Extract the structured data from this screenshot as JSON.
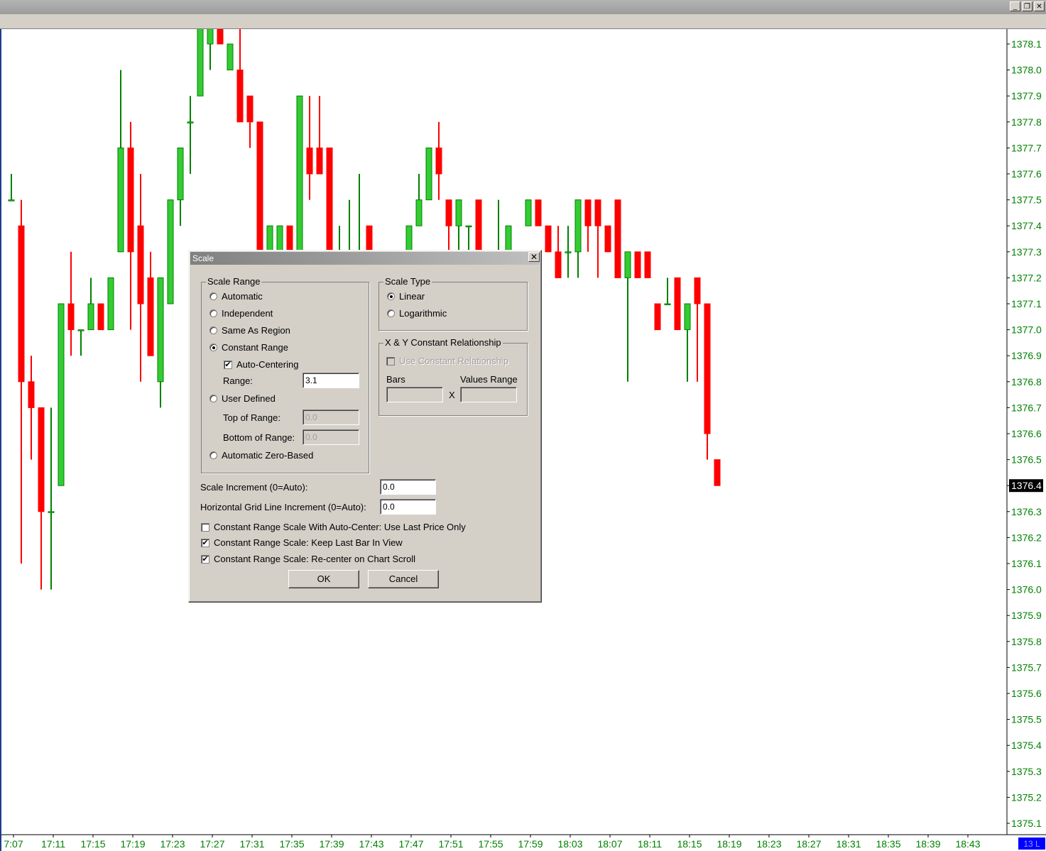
{
  "window": {
    "controls": [
      "_",
      "❐",
      "✕"
    ]
  },
  "colors": {
    "up": "#33cc33",
    "down": "#ff0000",
    "axis_text": "#008000",
    "last_bg": "#000000",
    "last_fg": "#ffffff",
    "time_text": "#008000",
    "corner_box": "#0000ff"
  },
  "chart_data": {
    "type": "candlestick",
    "y_ticks": [
      "1378.1",
      "1378.0",
      "1377.9",
      "1377.8",
      "1377.7",
      "1377.6",
      "1377.5",
      "1377.4",
      "1377.3",
      "1377.2",
      "1377.1",
      "1377.0",
      "1376.9",
      "1376.8",
      "1376.7",
      "1376.6",
      "1376.5",
      "1376.4",
      "1376.3",
      "1376.2",
      "1376.1",
      "1376.0",
      "1375.9",
      "1375.8",
      "1375.7",
      "1375.6",
      "1375.5",
      "1375.4",
      "1375.3",
      "1375.2",
      "1375.1"
    ],
    "last_price": "1376.4",
    "x_ticks": [
      "7:07",
      "17:11",
      "17:15",
      "17:19",
      "17:23",
      "17:27",
      "17:31",
      "17:35",
      "17:39",
      "17:43",
      "17:47",
      "17:51",
      "17:55",
      "17:59",
      "18:03",
      "18:07",
      "18:11",
      "18:15",
      "18:19",
      "18:23",
      "18:27",
      "18:31",
      "18:35",
      "18:39",
      "18:43"
    ],
    "corner_label": "13 L",
    "bars": [
      [
        1377.5,
        1377.6,
        1377.5,
        1377.5
      ],
      [
        1377.4,
        1377.5,
        1376.1,
        1376.8
      ],
      [
        1376.8,
        1376.9,
        1376.5,
        1376.7
      ],
      [
        1376.7,
        1376.7,
        1376.0,
        1376.3
      ],
      [
        1376.3,
        1376.7,
        1376.0,
        1376.3
      ],
      [
        1376.4,
        1377.1,
        1376.4,
        1377.1
      ],
      [
        1377.1,
        1377.3,
        1376.9,
        1377.0
      ],
      [
        1377.0,
        1377.0,
        1376.9,
        1377.0
      ],
      [
        1377.0,
        1377.2,
        1377.0,
        1377.1
      ],
      [
        1377.1,
        1377.1,
        1377.0,
        1377.0
      ],
      [
        1377.0,
        1377.2,
        1377.0,
        1377.2
      ],
      [
        1377.3,
        1378.0,
        1377.3,
        1377.7
      ],
      [
        1377.7,
        1377.8,
        1377.0,
        1377.3
      ],
      [
        1377.4,
        1377.6,
        1376.8,
        1377.1
      ],
      [
        1377.2,
        1377.3,
        1376.9,
        1376.9
      ],
      [
        1376.8,
        1377.2,
        1376.7,
        1377.2
      ],
      [
        1377.1,
        1377.5,
        1377.1,
        1377.5
      ],
      [
        1377.5,
        1377.7,
        1377.4,
        1377.7
      ],
      [
        1377.8,
        1377.9,
        1377.6,
        1377.8
      ],
      [
        1377.9,
        1378.2,
        1377.9,
        1378.2
      ],
      [
        1378.1,
        1378.2,
        1378.0,
        1378.2
      ],
      [
        1378.2,
        1378.2,
        1378.1,
        1378.1
      ],
      [
        1378.0,
        1378.1,
        1378.0,
        1378.1
      ],
      [
        1378.0,
        1378.2,
        1377.9,
        1377.8
      ],
      [
        1377.9,
        1377.9,
        1377.7,
        1377.8
      ],
      [
        1377.8,
        1377.8,
        1377.3,
        1377.3
      ],
      [
        1377.3,
        1377.4,
        1377.3,
        1377.4
      ],
      [
        1377.3,
        1377.4,
        1377.3,
        1377.4
      ],
      [
        1377.4,
        1377.4,
        1377.3,
        1377.3
      ],
      [
        1377.3,
        1377.6,
        1377.3,
        1377.9
      ],
      [
        1377.7,
        1377.9,
        1377.5,
        1377.6
      ],
      [
        1377.7,
        1377.9,
        1377.6,
        1377.6
      ],
      [
        1377.7,
        1377.7,
        1377.3,
        1377.3
      ],
      [
        1377.3,
        1377.4,
        1377.3,
        1377.3
      ],
      [
        1377.0,
        1377.5,
        1377.0,
        1377.3
      ],
      [
        1377.3,
        1377.6,
        1377.3,
        1377.3
      ],
      [
        1377.4,
        1377.4,
        1377.0,
        1377.1
      ],
      [
        1377.0,
        1377.3,
        1377.0,
        1377.1
      ],
      [
        1377.0,
        1377.2,
        1376.9,
        1377.2
      ],
      [
        1377.3,
        1377.3,
        1377.1,
        1377.1
      ],
      [
        1377.2,
        1377.4,
        1377.2,
        1377.4
      ],
      [
        1377.4,
        1377.6,
        1377.4,
        1377.5
      ],
      [
        1377.5,
        1377.7,
        1377.5,
        1377.7
      ],
      [
        1377.7,
        1377.8,
        1377.5,
        1377.6
      ],
      [
        1377.5,
        1377.5,
        1377.3,
        1377.4
      ],
      [
        1377.4,
        1377.5,
        1377.3,
        1377.5
      ],
      [
        1377.4,
        1377.4,
        1377.2,
        1377.4
      ],
      [
        1377.5,
        1377.5,
        1377.1,
        1377.3
      ],
      [
        1377.2,
        1377.3,
        1377.2,
        1377.3
      ],
      [
        1377.3,
        1377.5,
        1377.2,
        1377.3
      ],
      [
        1377.3,
        1377.4,
        1377.3,
        1377.4
      ],
      [
        1377.3,
        1377.3,
        1377.3,
        1377.3
      ],
      [
        1377.4,
        1377.5,
        1377.4,
        1377.5
      ],
      [
        1377.5,
        1377.5,
        1377.4,
        1377.4
      ],
      [
        1377.4,
        1377.4,
        1377.3,
        1377.3
      ],
      [
        1377.3,
        1377.4,
        1377.2,
        1377.2
      ],
      [
        1377.3,
        1377.4,
        1377.2,
        1377.3
      ],
      [
        1377.3,
        1377.5,
        1377.2,
        1377.5
      ],
      [
        1377.5,
        1377.5,
        1377.3,
        1377.4
      ],
      [
        1377.5,
        1377.5,
        1377.2,
        1377.4
      ],
      [
        1377.4,
        1377.4,
        1377.3,
        1377.3
      ],
      [
        1377.5,
        1377.5,
        1377.2,
        1377.2
      ],
      [
        1377.2,
        1377.3,
        1376.8,
        1377.3
      ],
      [
        1377.3,
        1377.3,
        1377.2,
        1377.2
      ],
      [
        1377.3,
        1377.3,
        1377.2,
        1377.2
      ],
      [
        1377.1,
        1377.1,
        1377.0,
        1377.0
      ],
      [
        1377.1,
        1377.2,
        1377.1,
        1377.1
      ],
      [
        1377.2,
        1377.2,
        1377.0,
        1377.0
      ],
      [
        1377.0,
        1377.1,
        1376.8,
        1377.1
      ],
      [
        1377.2,
        1377.2,
        1376.8,
        1377.1
      ],
      [
        1377.1,
        1377.1,
        1376.5,
        1376.6
      ],
      [
        1376.5,
        1376.5,
        1376.4,
        1376.4
      ]
    ]
  },
  "dialog": {
    "title": "Scale",
    "close": "✕",
    "scale_range": {
      "legend": "Scale Range",
      "automatic": "Automatic",
      "independent": "Independent",
      "same_as_region": "Same As Region",
      "constant_range": "Constant Range",
      "auto_centering": "Auto-Centering",
      "range_label": "Range:",
      "range_value": "3.1",
      "user_defined": "User Defined",
      "top_label": "Top of Range:",
      "top_value": "0.0",
      "bottom_label": "Bottom of Range:",
      "bottom_value": "0.0",
      "zero_based": "Automatic Zero-Based",
      "selected": "Constant Range"
    },
    "scale_type": {
      "legend": "Scale Type",
      "linear": "Linear",
      "logarithmic": "Logarithmic",
      "selected": "Linear"
    },
    "xy": {
      "legend": "X & Y Constant Relationship",
      "use_label": "Use Constant Relationship",
      "bars_label": "Bars",
      "values_label": "Values Range",
      "x_label": "X"
    },
    "scale_increment_label": "Scale Increment (0=Auto):",
    "scale_increment_value": "0.0",
    "grid_increment_label": "Horizontal Grid Line Increment (0=Auto):",
    "grid_increment_value": "0.0",
    "opt_last_price": "Constant Range Scale With Auto-Center: Use Last Price Only",
    "opt_keep_last": "Constant Range Scale: Keep Last Bar In View",
    "opt_recenter": "Constant Range Scale: Re-center on Chart Scroll",
    "ok": "OK",
    "cancel": "Cancel"
  }
}
